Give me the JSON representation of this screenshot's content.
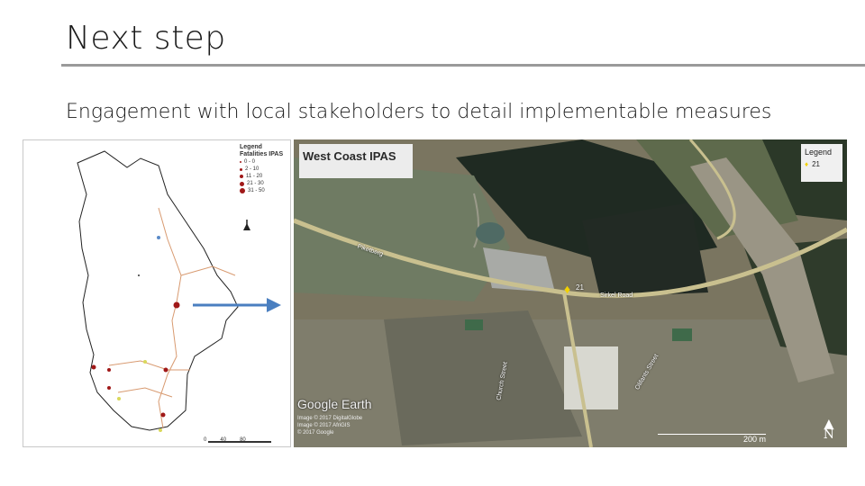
{
  "slide": {
    "title": "Next step",
    "subtitle": "Engagement with local stakeholders to detail implementable measures"
  },
  "left_map": {
    "legend_title": "Legend",
    "legend_subtitle": "Fatalities IPAS",
    "legend_items": [
      "0 - 0",
      "2 - 10",
      "11 - 20",
      "21 - 30",
      "31 - 50"
    ],
    "north_label": "N",
    "scale_labels": [
      "0",
      "40",
      "80"
    ]
  },
  "right_map": {
    "title": "West Coast IPAS",
    "legend_title": "Legend",
    "legend_item": "21",
    "marker_label": "21",
    "logo": "Google Earth",
    "credits": [
      "Image © 2017 DigitalGlobe",
      "Image © 2017 AfriGIS",
      "© 2017 Google"
    ],
    "scale_label": "200 m",
    "north_label": "N",
    "road_labels": [
      "Piketberg",
      "Sirkel Road",
      "Church Street",
      "Olifants Street"
    ]
  }
}
